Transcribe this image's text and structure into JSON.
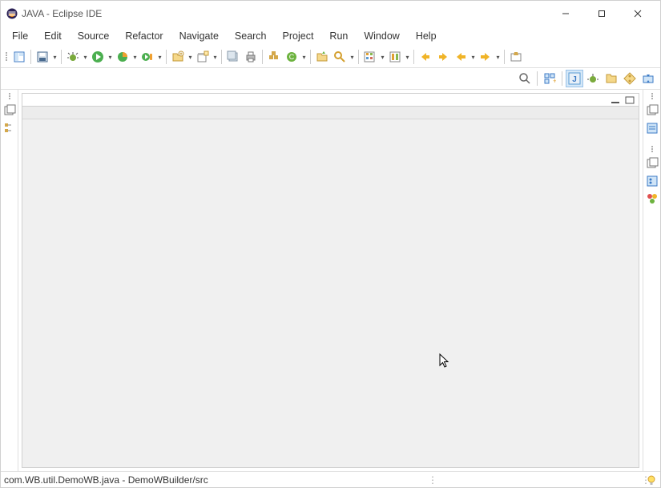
{
  "title": "JAVA - Eclipse IDE",
  "menu": {
    "file": "File",
    "edit": "Edit",
    "source": "Source",
    "refactor": "Refactor",
    "navigate": "Navigate",
    "search": "Search",
    "project": "Project",
    "run": "Run",
    "window": "Window",
    "help": "Help"
  },
  "status": {
    "left": "com.WB.util.DemoWB.java - DemoWBuilder/src"
  }
}
